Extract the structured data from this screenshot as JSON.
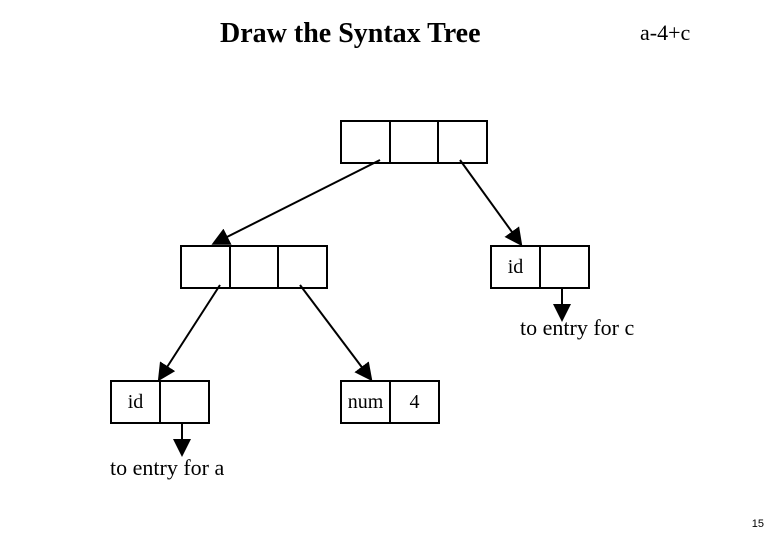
{
  "title": "Draw the Syntax Tree",
  "expression": "a-4+c",
  "nodes": {
    "root": {
      "c1": "",
      "c2": "",
      "c3": ""
    },
    "left": {
      "c1": "",
      "c2": "",
      "c3": ""
    },
    "right": {
      "c1": "id",
      "c2": ""
    },
    "leafA": {
      "c1": "id",
      "c2": ""
    },
    "leafNum": {
      "c1": "num",
      "c2": "4"
    }
  },
  "annotations": {
    "entry_c": "to entry for c",
    "entry_a": "to entry for a"
  },
  "page_number": "15"
}
